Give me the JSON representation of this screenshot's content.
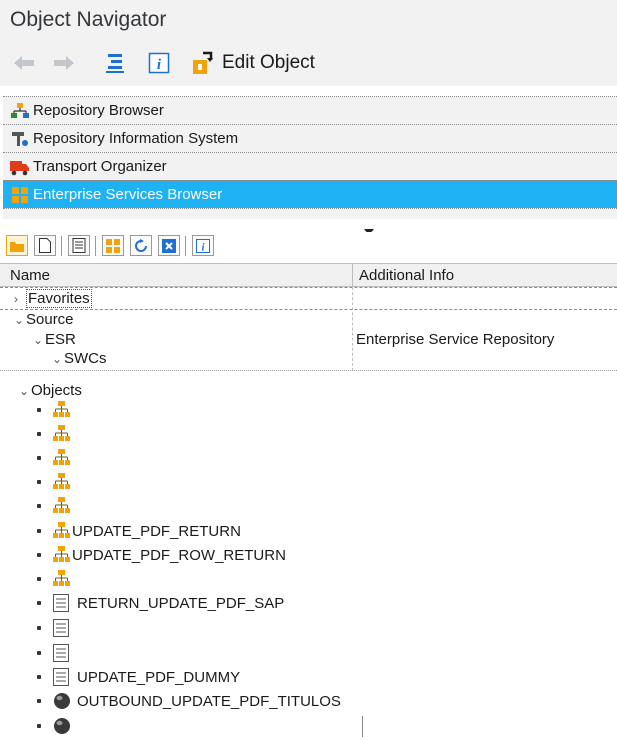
{
  "window": {
    "title": "Object Navigator"
  },
  "toolbar": {
    "back_icon": "arrow-left-icon",
    "forward_icon": "arrow-right-icon",
    "edit_label": "Edit Object"
  },
  "browsers": [
    {
      "label": "Repository Browser",
      "icon": "hierarchy-icon",
      "active": false
    },
    {
      "label": "Repository Information System",
      "icon": "tools-icon",
      "active": false
    },
    {
      "label": "Transport Organizer",
      "icon": "truck-icon",
      "active": false
    },
    {
      "label": "Enterprise Services Browser",
      "icon": "grid-icon",
      "active": true
    }
  ],
  "tree": {
    "columns": {
      "name": "Name",
      "info": "Additional Info"
    },
    "rows": [
      {
        "name": "Favorites",
        "info": "",
        "expanded": false
      },
      {
        "name": "Source",
        "info": "",
        "expanded": true
      },
      {
        "name": "ESR",
        "info": "Enterprise Service Repository",
        "expanded": true
      },
      {
        "name": "SWCs",
        "info": "",
        "expanded": true
      }
    ],
    "objects_label": "Objects",
    "objects": [
      {
        "label": "",
        "icon": "structure-icon"
      },
      {
        "label": "",
        "icon": "structure-icon"
      },
      {
        "label": "",
        "icon": "structure-icon"
      },
      {
        "label": "",
        "icon": "structure-icon"
      },
      {
        "label": "",
        "icon": "structure-icon"
      },
      {
        "label": "UPDATE_PDF_RETURN",
        "icon": "structure-icon"
      },
      {
        "label": "UPDATE_PDF_ROW_RETURN",
        "icon": "structure-icon"
      },
      {
        "label": "",
        "icon": "structure-icon"
      },
      {
        "label": "RETURN_UPDATE_PDF_SAP",
        "icon": "document-icon"
      },
      {
        "label": "",
        "icon": "document-icon"
      },
      {
        "label": "",
        "icon": "document-icon"
      },
      {
        "label": "UPDATE_PDF_DUMMY",
        "icon": "document-icon"
      },
      {
        "label": "OUTBOUND_UPDATE_PDF_TITULOS",
        "icon": "sphere-icon"
      },
      {
        "label": "",
        "icon": "sphere-icon"
      }
    ]
  },
  "colors": {
    "accent": "#1eb2f2",
    "toolbar_blue": "#1f6fd1",
    "icon_orange": "#f0a30a"
  }
}
